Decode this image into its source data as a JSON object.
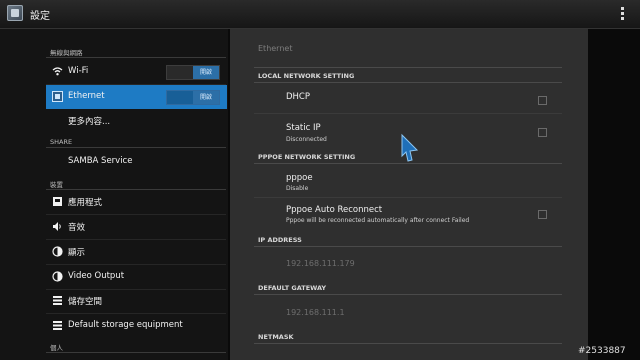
{
  "header": {
    "title": "設定",
    "app_icon": "settings-app-icon",
    "menu_icon": "overflow-menu-icon"
  },
  "sidebar": {
    "sections": {
      "wireless": "無線與網路",
      "share": "SHARE",
      "device": "裝置",
      "personal": "個人"
    },
    "items": [
      {
        "label": "Wi-Fi",
        "icon": "wifi-icon",
        "toggle": "開啟"
      },
      {
        "label": "Ethernet",
        "icon": "ethernet-icon",
        "toggle": "開啟",
        "selected": true
      },
      {
        "label": "更多內容..."
      },
      {
        "label": "SAMBA Service"
      },
      {
        "label": "應用程式",
        "icon": "apps-icon"
      },
      {
        "label": "音效",
        "icon": "sound-icon"
      },
      {
        "label": "顯示",
        "icon": "display-icon"
      },
      {
        "label": "Video Output",
        "icon": "video-output-icon"
      },
      {
        "label": "儲存空間",
        "icon": "storage-icon"
      },
      {
        "label": "Default storage equipment",
        "icon": "default-storage-icon"
      }
    ]
  },
  "main": {
    "title": "Ethernet",
    "local_section": "LOCAL NETWORK SETTING",
    "dhcp": {
      "title": "DHCP"
    },
    "static_ip": {
      "title": "Static IP",
      "summary": "Disconnected"
    },
    "pppoe_section": "PPPOE NETWORK SETTING",
    "pppoe": {
      "title": "pppoe",
      "summary": "Disable"
    },
    "pppoe_auto": {
      "title": "Pppoe Auto Reconnect",
      "summary": "Pppoe will be reconnected automatically after connect Failed"
    },
    "ip_section": "IP ADDRESS",
    "ip_value": "192.168.111.179",
    "gateway_section": "DEFAULT GATEWAY",
    "gateway_value": "192.168.111.1",
    "netmask_section": "NETMASK"
  },
  "watermark": "#2533887",
  "colors": {
    "accent": "#1e7bc4",
    "toggle_on": "#2c6fa7",
    "pane": "#2f2f2f"
  }
}
